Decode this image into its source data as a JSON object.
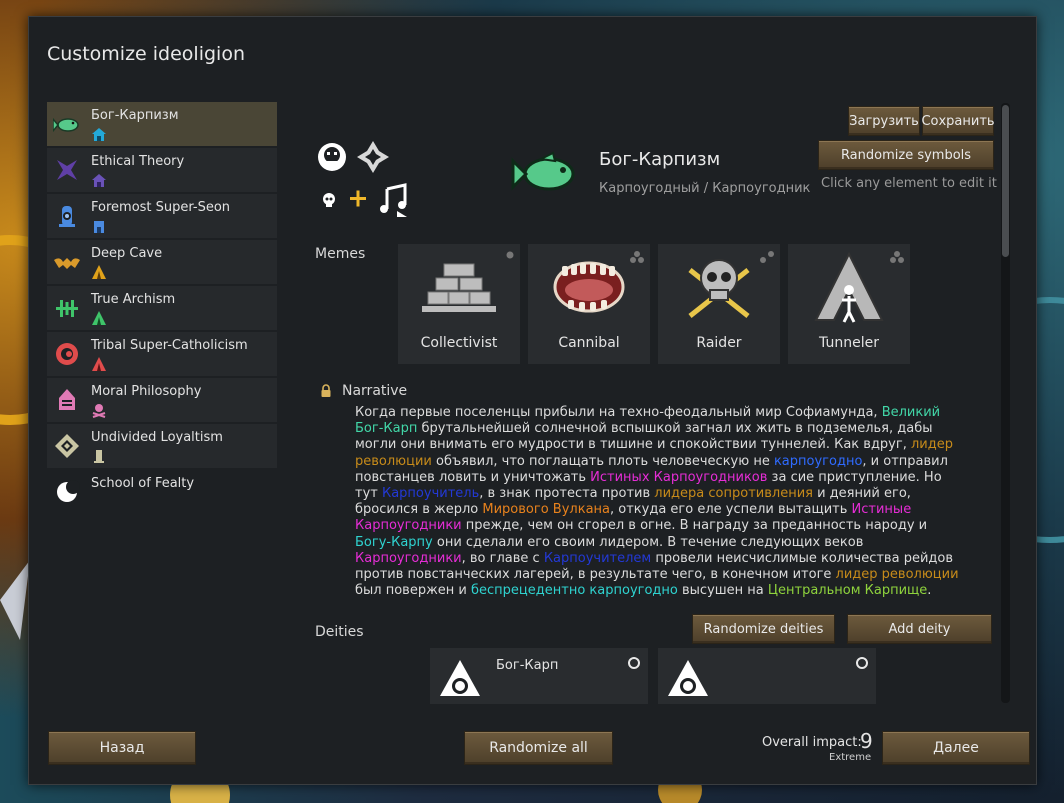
{
  "dialog": {
    "title": "Customize ideoligion"
  },
  "sidebar": {
    "items": [
      {
        "label": "Бог-Карпизм",
        "icon": "fish-icon",
        "color": "#56c98a"
      },
      {
        "label": "Ethical Theory",
        "icon": "star-emblem-icon",
        "color": "#5f3fa6"
      },
      {
        "label": "Foremost Super-Seon",
        "icon": "ornate-emblem-icon",
        "color": "#4a8ae0"
      },
      {
        "label": "Deep Cave",
        "icon": "bat-icon",
        "color": "#d99a2b"
      },
      {
        "label": "True Archism",
        "icon": "trident-icon",
        "color": "#3fc46a"
      },
      {
        "label": "Tribal Super-Catholicism",
        "icon": "eye-icon",
        "color": "#e04c4c"
      },
      {
        "label": "Moral Philosophy",
        "icon": "bell-icon",
        "color": "#e07ab5"
      },
      {
        "label": "Undivided Loyaltism",
        "icon": "diamond-icon",
        "color": "#c9c5a3"
      },
      {
        "label": "School of Fealty",
        "icon": "moon-icon",
        "color": "#ffffff"
      }
    ]
  },
  "header": {
    "load_label": "Загрузить",
    "save_label": "Сохранить",
    "randomize_symbols_label": "Randomize symbols",
    "edit_hint": "Click any element to edit it",
    "ideo_name": "Бог-Карпизм",
    "ideo_adjective": "Карпоугодный / Карпоугодник"
  },
  "memes": {
    "section_label": "Memes",
    "items": [
      {
        "label": "Collectivist",
        "icon": "bricks-icon"
      },
      {
        "label": "Cannibal",
        "icon": "mouth-icon"
      },
      {
        "label": "Raider",
        "icon": "skull-swords-icon"
      },
      {
        "label": "Tunneler",
        "icon": "mountain-figure-icon"
      }
    ]
  },
  "narrative": {
    "label": "Narrative",
    "lock_icon": "lock-icon",
    "segments": [
      {
        "t": "Когда первые поселенцы прибыли на техно-феодальный мир Софиамунда, ",
        "c": ""
      },
      {
        "t": "Великий Бог-Карп",
        "c": "c-green"
      },
      {
        "t": " брутальнейшей солнечной вспышкой загнал их жить в подземелья, дабы могли они внимать его мудрости в тишине и спокойствии туннелей. Как вдруг, ",
        "c": ""
      },
      {
        "t": "лидер революции",
        "c": "c-orange"
      },
      {
        "t": " объявил, что поглащать плоть человеческую не ",
        "c": ""
      },
      {
        "t": "карпоугодно",
        "c": "c-blue"
      },
      {
        "t": ", и отправил повстанцев ловить и уничтожать ",
        "c": ""
      },
      {
        "t": "Истиных Карпоугодников",
        "c": "c-mag"
      },
      {
        "t": " за сие приступление. Но тут ",
        "c": ""
      },
      {
        "t": "Карпоучитель",
        "c": "c-dkblue"
      },
      {
        "t": ", в знак протеста против ",
        "c": ""
      },
      {
        "t": "лидера сопротивления",
        "c": "c-orange"
      },
      {
        "t": " и деяний его, бросился в жерло ",
        "c": ""
      },
      {
        "t": "Мирового Вулкана",
        "c": "c-red"
      },
      {
        "t": ", откуда его еле успели вытащить ",
        "c": ""
      },
      {
        "t": "Истиные Карпоугодники",
        "c": "c-mag"
      },
      {
        "t": " прежде, чем он сгорел в огне. В награду за преданность народу и ",
        "c": ""
      },
      {
        "t": "Богу-Карпу",
        "c": "c-cyan"
      },
      {
        "t": " они сделали его своим лидером. В течение следующих веков ",
        "c": ""
      },
      {
        "t": "Карпоугодники",
        "c": "c-mag"
      },
      {
        "t": ", во главе с ",
        "c": ""
      },
      {
        "t": "Карпоучителем",
        "c": "c-dkblue"
      },
      {
        "t": " провели неисчислимые количества рейдов против повстанческих лагерей, в результате чего, в конечном итоге ",
        "c": ""
      },
      {
        "t": "лидер революции",
        "c": "c-orange"
      },
      {
        "t": " был повержен и ",
        "c": ""
      },
      {
        "t": "беспрецедентно карпоугодно",
        "c": "c-cyan"
      },
      {
        "t": " высушен на ",
        "c": ""
      },
      {
        "t": "Центральном Карпище",
        "c": "c-lime"
      },
      {
        "t": ".",
        "c": ""
      }
    ]
  },
  "deities": {
    "section_label": "Deities",
    "randomize_label": "Randomize deities",
    "add_label": "Add deity",
    "items": [
      {
        "name": "Бог-Карп",
        "icon": "triangle-circle-icon"
      },
      {
        "name": "",
        "icon": "triangle-circle-icon"
      }
    ]
  },
  "footer": {
    "back_label": "Назад",
    "randomize_all_label": "Randomize all",
    "impact_label": "Overall impact:",
    "impact_value": "9",
    "impact_level": "Extreme",
    "next_label": "Далее"
  }
}
